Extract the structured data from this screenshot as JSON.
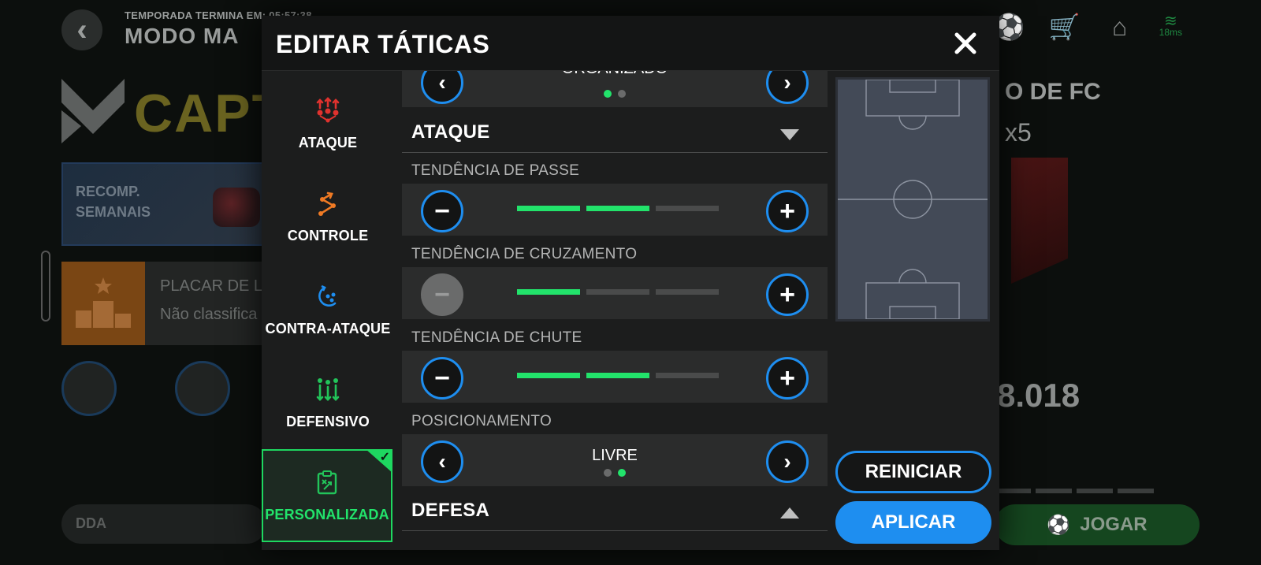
{
  "background": {
    "season_text": "TEMPORADA TERMINA EM: 05:57:38",
    "mode_title": "MODO MA",
    "brand_text": "CAPTA",
    "reward_card": [
      "RECOMP.",
      "SEMANAIS"
    ],
    "leaderboard": {
      "title": "PLACAR DE L",
      "subtitle": "Não classifica"
    },
    "dda_label": "DDA",
    "right_title": "O DE FC",
    "right_sub": "x5",
    "score": "8.018",
    "play_button": "JOGAR",
    "ping": "18ms"
  },
  "modal": {
    "title": "EDITAR TÁTICAS",
    "tabs": [
      {
        "label": "ATAQUE",
        "icon": "attack-icon"
      },
      {
        "label": "CONTROLE",
        "icon": "control-icon"
      },
      {
        "label": "CONTRA-ATAQUE",
        "icon": "counter-attack-icon"
      },
      {
        "label": "DEFENSIVO",
        "icon": "defensive-icon"
      },
      {
        "label": "PERSONALIZADA",
        "icon": "custom-tactics-icon",
        "selected": true
      }
    ],
    "top_selector": {
      "value": "ORGANIZADO",
      "page": 1,
      "pages": 2
    },
    "sections": [
      {
        "title": "ATAQUE",
        "expanded": true,
        "settings": [
          {
            "label": "TENDÊNCIA DE PASSE",
            "level": 2,
            "max": 3
          },
          {
            "label": "TENDÊNCIA DE CRUZAMENTO",
            "level": 1,
            "max": 3
          },
          {
            "label": "TENDÊNCIA DE CHUTE",
            "level": 2,
            "max": 3
          }
        ],
        "positioning": {
          "label": "POSICIONAMENTO",
          "value": "LIVRE",
          "page": 2,
          "pages": 2
        }
      },
      {
        "title": "DEFESA",
        "expanded": false
      }
    ],
    "buttons": {
      "reset": "REINICIAR",
      "apply": "APLICAR"
    },
    "colors": {
      "accent_blue": "#1e8ef0",
      "accent_green": "#22e36b",
      "panel": "#1c1d1d",
      "row": "#2b2c2c"
    }
  }
}
